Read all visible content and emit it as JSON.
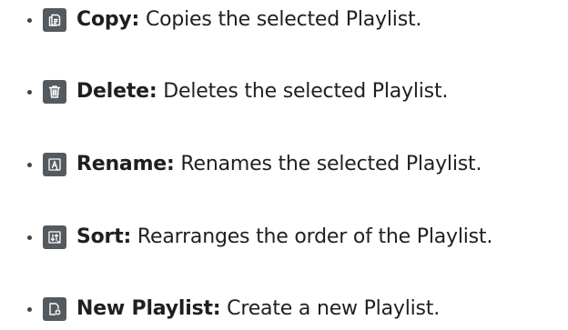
{
  "items": [
    {
      "icon": "copy-icon",
      "term": "Copy:",
      "description": " Copies the selected Playlist."
    },
    {
      "icon": "delete-icon",
      "term": "Delete:",
      "description": " Deletes the selected Playlist."
    },
    {
      "icon": "rename-icon",
      "term": "Rename:",
      "description": " Renames the selected Playlist."
    },
    {
      "icon": "sort-icon",
      "term": "Sort:",
      "description": " Rearranges the order of the Playlist."
    },
    {
      "icon": "new-playlist-icon",
      "term": "New Playlist:",
      "description": " Create a new Playlist."
    }
  ],
  "colors": {
    "icon_background": "#555a5f",
    "text": "#1f1f1f"
  }
}
